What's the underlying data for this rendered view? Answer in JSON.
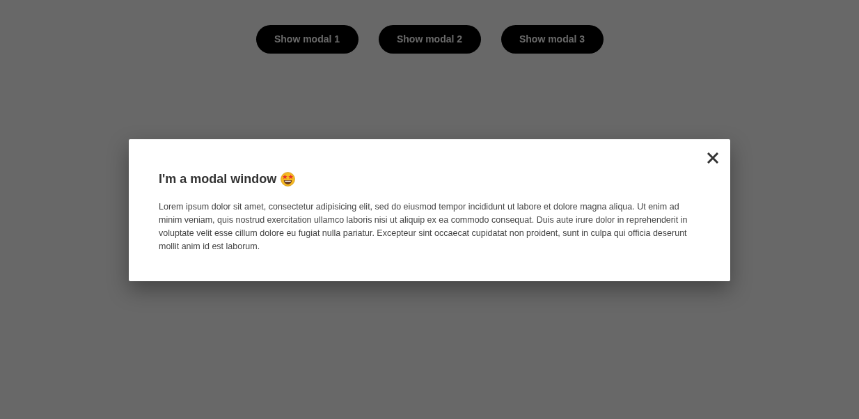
{
  "buttons": [
    {
      "label": "Show modal 1"
    },
    {
      "label": "Show modal 2"
    },
    {
      "label": "Show modal 3"
    }
  ],
  "modal": {
    "title": "I'm a modal window",
    "body": "Lorem ipsum dolor sit amet, consectetur adipisicing elit, sed do eiusmod tempor incididunt ut labore et dolore magna aliqua. Ut enim ad minim veniam, quis nostrud exercitation ullamco laboris nisi ut aliquip ex ea commodo consequat. Duis aute irure dolor in reprehenderit in voluptate velit esse cillum dolore eu fugiat nulla pariatur. Excepteur sint occaecat cupidatat non proident, sunt in culpa qui officia deserunt mollit anim id est laborum."
  }
}
